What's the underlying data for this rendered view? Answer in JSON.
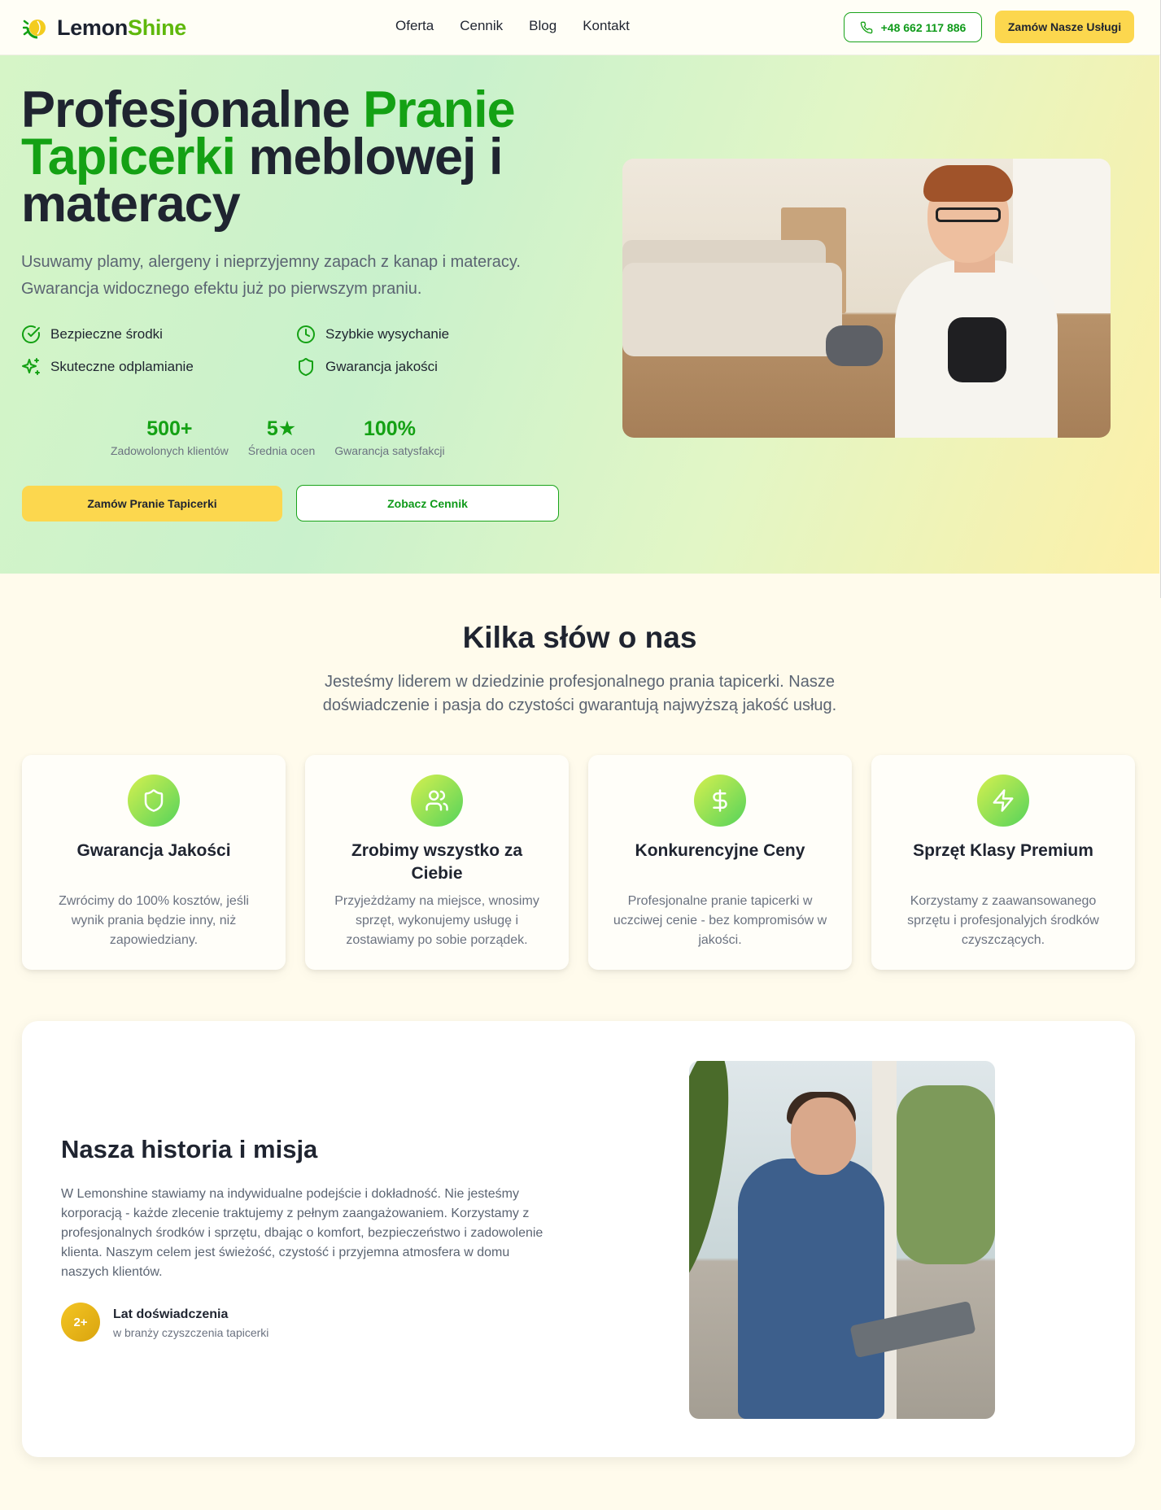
{
  "nav": {
    "logo_part1": "Lemon",
    "logo_part2": "Shine",
    "links": [
      "Oferta",
      "Cennik",
      "Blog",
      "Kontakt"
    ],
    "phone": "+48 662 117 886",
    "order_label": "Zamów Nasze Usługi"
  },
  "hero": {
    "title_part1": "Profesjonalne ",
    "title_highlight": "Pranie Tapicerki",
    "title_part2": " meblowej i materacy",
    "subtitle": "Usuwamy plamy, alergeny i nieprzyjemny zapach z kanap i materacy. Gwarancja widocznego efektu już po pierwszym praniu.",
    "features": [
      {
        "label": "Bezpieczne środki",
        "icon": "check-circle-icon"
      },
      {
        "label": "Szybkie wysychanie",
        "icon": "clock-icon"
      },
      {
        "label": "Skuteczne odplamianie",
        "icon": "sparkles-icon"
      },
      {
        "label": "Gwarancja jakości",
        "icon": "shield-icon"
      }
    ],
    "stats": [
      {
        "value": "500+",
        "label": "Zadowolonych klientów"
      },
      {
        "value": "5★",
        "label": "Średnia ocen"
      },
      {
        "value": "100%",
        "label": "Gwarancja satysfakcji"
      }
    ],
    "cta_primary": "Zamów Pranie Tapicerki",
    "cta_secondary": "Zobacz Cennik"
  },
  "about": {
    "title": "Kilka słów o nas",
    "subtitle": "Jesteśmy liderem w dziedzinie profesjonalnego prania tapicerki. Nasze doświadczenie i pasja do czystości gwarantują najwyższą jakość usług.",
    "cards": [
      {
        "icon": "shield-icon",
        "title": "Gwarancja Jakości",
        "text": "Zwrócimy do 100% kosztów, jeśli wynik prania będzie inny, niż zapowiedziany."
      },
      {
        "icon": "users-icon",
        "title": "Zrobimy wszystko za Ciebie",
        "text": "Przyjeżdżamy na miejsce, wnosimy sprzęt, wykonujemy usługę i zostawiamy po sobie porządek."
      },
      {
        "icon": "dollar-icon",
        "title": "Konkurencyjne Ceny",
        "text": "Profesjonalne pranie tapicerki w uczciwej cenie - bez kompromisów w jakości."
      },
      {
        "icon": "lightning-icon",
        "title": "Sprzęt Klasy Premium",
        "text": "Korzystamy z zaawansowanego sprzętu i profesjonalyjch środków czyszczących."
      }
    ]
  },
  "history": {
    "title": "Nasza historia i misja",
    "text": "W Lemonshine stawiamy na indywidualne podejście i dokładność. Nie jesteśmy korporacją - każde zlecenie traktujemy z pełnym zaangażowaniem. Korzystamy z profesjonalnych środków i sprzętu, dbając o komfort, bezpieczeństwo i zadowolenie klienta. Naszym celem jest świeżość, czystość i przyjemna atmosfera w domu naszych klientów.",
    "badge": "2+",
    "exp_title": "Lat doświadczenia",
    "exp_sub": "w branży czyszczenia tapicerki"
  },
  "colors": {
    "brand_green": "#14a114",
    "accent_yellow": "#fcd74e",
    "text_dark": "#1f2430"
  }
}
